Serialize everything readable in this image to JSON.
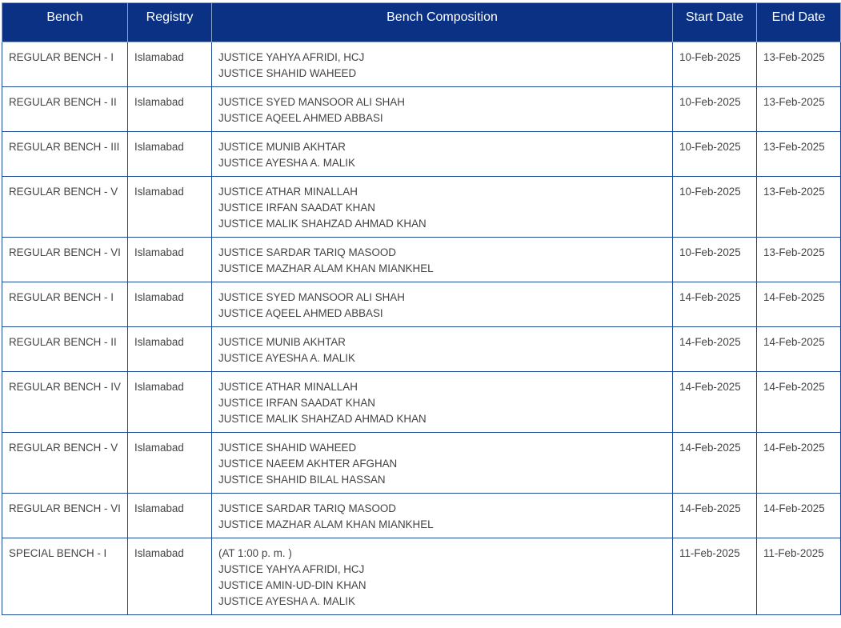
{
  "table": {
    "headers": {
      "bench": "Bench",
      "registry": "Registry",
      "composition": "Bench Composition",
      "start": "Start Date",
      "end": "End Date"
    },
    "rows": [
      {
        "bench": "REGULAR BENCH - I",
        "registry": "Islamabad",
        "composition": [
          "JUSTICE YAHYA AFRIDI, HCJ",
          "JUSTICE SHAHID WAHEED"
        ],
        "start": "10-Feb-2025",
        "end": "13-Feb-2025"
      },
      {
        "bench": "REGULAR BENCH - II",
        "registry": "Islamabad",
        "composition": [
          "JUSTICE SYED MANSOOR ALI SHAH",
          "JUSTICE AQEEL AHMED ABBASI"
        ],
        "start": "10-Feb-2025",
        "end": "13-Feb-2025"
      },
      {
        "bench": "REGULAR BENCH - III",
        "registry": "Islamabad",
        "composition": [
          "JUSTICE MUNIB AKHTAR",
          "JUSTICE AYESHA A. MALIK"
        ],
        "start": "10-Feb-2025",
        "end": "13-Feb-2025"
      },
      {
        "bench": "REGULAR BENCH - V",
        "registry": "Islamabad",
        "composition": [
          "JUSTICE ATHAR MINALLAH",
          "JUSTICE IRFAN SAADAT KHAN",
          "JUSTICE MALIK SHAHZAD AHMAD KHAN"
        ],
        "start": "10-Feb-2025",
        "end": "13-Feb-2025"
      },
      {
        "bench": "REGULAR BENCH - VI",
        "registry": "Islamabad",
        "composition": [
          "JUSTICE SARDAR TARIQ MASOOD",
          "JUSTICE MAZHAR ALAM KHAN MIANKHEL"
        ],
        "start": "10-Feb-2025",
        "end": "13-Feb-2025"
      },
      {
        "bench": "REGULAR BENCH - I",
        "registry": "Islamabad",
        "composition": [
          "JUSTICE SYED MANSOOR ALI SHAH",
          "JUSTICE AQEEL AHMED ABBASI"
        ],
        "start": "14-Feb-2025",
        "end": "14-Feb-2025"
      },
      {
        "bench": "REGULAR BENCH - II",
        "registry": "Islamabad",
        "composition": [
          "JUSTICE MUNIB AKHTAR",
          "JUSTICE AYESHA A. MALIK"
        ],
        "start": "14-Feb-2025",
        "end": "14-Feb-2025"
      },
      {
        "bench": "REGULAR BENCH - IV",
        "registry": "Islamabad",
        "composition": [
          "JUSTICE ATHAR MINALLAH",
          "JUSTICE IRFAN SAADAT KHAN",
          "JUSTICE MALIK SHAHZAD AHMAD KHAN"
        ],
        "start": "14-Feb-2025",
        "end": "14-Feb-2025"
      },
      {
        "bench": "REGULAR BENCH - V",
        "registry": "Islamabad",
        "composition": [
          "JUSTICE SHAHID WAHEED",
          "JUSTICE NAEEM AKHTER AFGHAN",
          "JUSTICE SHAHID BILAL HASSAN"
        ],
        "start": "14-Feb-2025",
        "end": "14-Feb-2025"
      },
      {
        "bench": "REGULAR BENCH - VI",
        "registry": "Islamabad",
        "composition": [
          "JUSTICE SARDAR TARIQ MASOOD",
          "JUSTICE MAZHAR ALAM KHAN MIANKHEL"
        ],
        "start": "14-Feb-2025",
        "end": "14-Feb-2025"
      },
      {
        "bench": "SPECIAL BENCH - I",
        "registry": "Islamabad",
        "composition": [
          "(AT 1:00 p. m. )",
          "JUSTICE YAHYA AFRIDI, HCJ",
          "JUSTICE AMIN-UD-DIN KHAN",
          "JUSTICE AYESHA A. MALIK"
        ],
        "start": "11-Feb-2025",
        "end": "11-Feb-2025"
      }
    ]
  },
  "colors": {
    "header_bg": "#0a3184",
    "header_text": "#ffffff",
    "border": "#1c4a97",
    "cell_text": "#444444"
  }
}
